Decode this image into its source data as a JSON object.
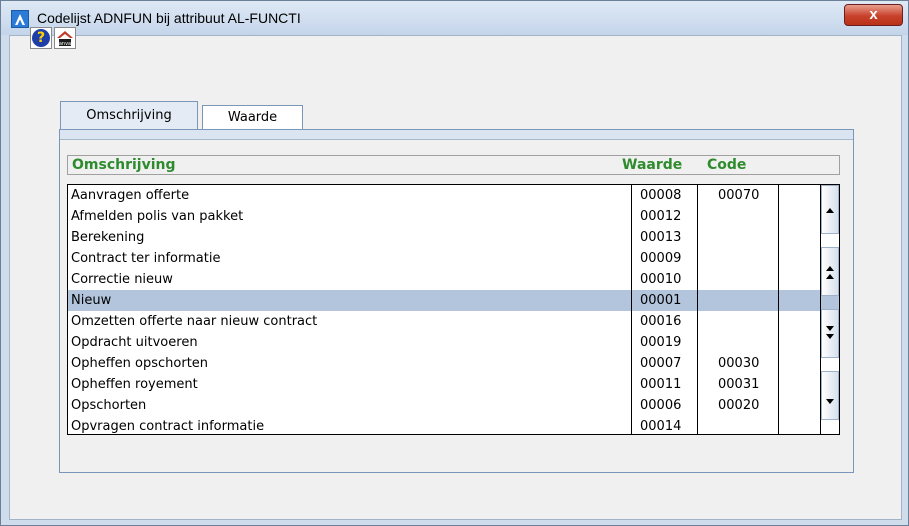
{
  "window": {
    "title": "Codelijst ADNFUN bij attribuut AL-FUNCTI",
    "close_label": "x"
  },
  "toolbar": {
    "help_label": "?",
    "anva_label": "anva"
  },
  "tabs": [
    {
      "label": "Omschrijving",
      "active": true
    },
    {
      "label": "Waarde",
      "active": false
    }
  ],
  "list": {
    "headers": {
      "omschrijving": "Omschrijving",
      "waarde": "Waarde",
      "code": "Code"
    },
    "header_color": "#2e8b2e",
    "selected_color": "#b3c4dd",
    "rows": [
      {
        "omschrijving": "Aanvragen offerte",
        "waarde": "00008",
        "code": "00070"
      },
      {
        "omschrijving": "Afmelden polis van pakket",
        "waarde": "00012",
        "code": ""
      },
      {
        "omschrijving": "Berekening",
        "waarde": "00013",
        "code": ""
      },
      {
        "omschrijving": "Contract ter informatie",
        "waarde": "00009",
        "code": ""
      },
      {
        "omschrijving": "Correctie nieuw",
        "waarde": "00010",
        "code": ""
      },
      {
        "omschrijving": "Nieuw",
        "waarde": "00001",
        "code": "",
        "selected": true
      },
      {
        "omschrijving": "Omzetten offerte naar nieuw contract",
        "waarde": "00016",
        "code": ""
      },
      {
        "omschrijving": "Opdracht uitvoeren",
        "waarde": "00019",
        "code": ""
      },
      {
        "omschrijving": "Opheffen opschorten",
        "waarde": "00007",
        "code": "00030"
      },
      {
        "omschrijving": "Opheffen royement",
        "waarde": "00011",
        "code": "00031"
      },
      {
        "omschrijving": "Opschorten",
        "waarde": "00006",
        "code": "00020"
      },
      {
        "omschrijving": "Opvragen contract informatie",
        "waarde": "00014",
        "code": ""
      }
    ]
  },
  "scroll_buttons": [
    {
      "name": "scroll-up-button",
      "icon": "arrow-up-icon"
    },
    {
      "name": "page-up-button",
      "icon": "double-arrow-up-icon"
    },
    {
      "name": "page-down-button",
      "icon": "double-arrow-down-icon"
    },
    {
      "name": "scroll-down-button",
      "icon": "arrow-down-icon"
    }
  ]
}
